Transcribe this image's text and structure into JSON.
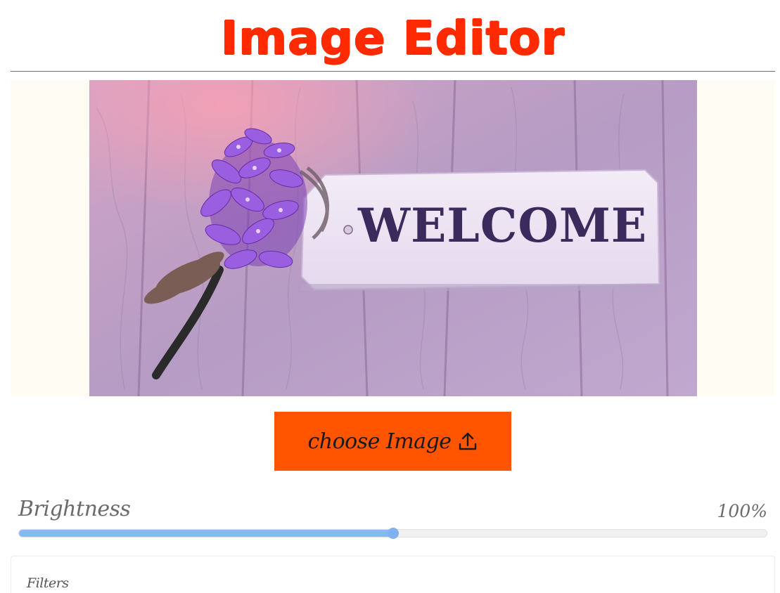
{
  "header": {
    "title": "Image Editor"
  },
  "preview": {
    "sign_text": "WELCOME"
  },
  "upload": {
    "button_label": "choose Image",
    "icon": "upload-icon"
  },
  "brightness": {
    "label": "Brightness",
    "value_text": "100%",
    "level": 0.5
  },
  "filters": {
    "title": "Filters"
  },
  "colors": {
    "title": "#ff2a00",
    "button": "#ff5500",
    "slider_fill": "#86b9f2",
    "canvas_bg": "#fffcf4"
  }
}
